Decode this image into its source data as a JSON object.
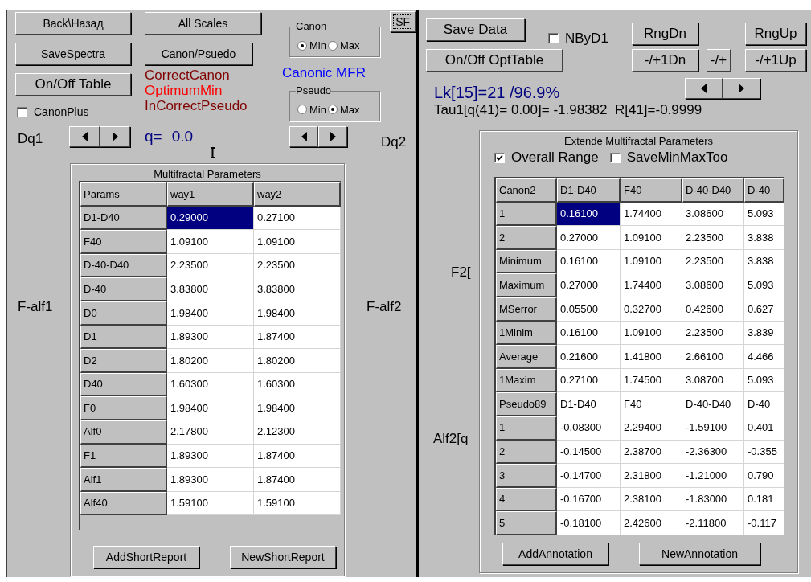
{
  "left": {
    "back_button": "Back\\Назад",
    "all_scales_button": "All Scales",
    "save_spectra_button": "SaveSpectra",
    "canon_pseudo_button": "Canon/Psuedo",
    "table_toggle_button": "On/Off Table",
    "canon_plus": {
      "label": "CanonPlus",
      "checked": false
    },
    "status_labels": [
      {
        "text": "CorrectCanon",
        "color": "#800000"
      },
      {
        "text": "OptimumMin",
        "color": "#ff0000"
      },
      {
        "text": "InCorrectPseudo",
        "color": "#800000"
      }
    ],
    "canon_group": {
      "title": "Canon",
      "options": [
        {
          "label": "Min",
          "selected": true
        },
        {
          "label": "Max",
          "selected": false
        }
      ]
    },
    "mode_label": "Canonic MFR",
    "pseudo_group": {
      "title": "Pseudo",
      "options": [
        {
          "label": "Min",
          "selected": false
        },
        {
          "label": "Max",
          "selected": true
        }
      ]
    },
    "sf_button": "SF",
    "dq1_label": "Dq1",
    "q_label": "q=",
    "q_value": "0.0",
    "dq2_label": "Dq2",
    "f_alf1_label": "F-alf1",
    "f_alf2_label": "F-alf2",
    "table": {
      "title": "Multifractal Parameters",
      "columns": [
        "Params",
        "way1",
        "way2"
      ],
      "rows": [
        {
          "cells": [
            {
              "kind": "header",
              "text": "D1-D40"
            },
            {
              "kind": "value",
              "text": "0.29000",
              "selected": true
            },
            {
              "kind": "value",
              "text": "0.27100",
              "selected": false
            }
          ]
        },
        {
          "cells": [
            {
              "kind": "header",
              "text": "F40"
            },
            {
              "kind": "value",
              "text": "1.09100",
              "selected": false
            },
            {
              "kind": "value",
              "text": "1.09100",
              "selected": false
            }
          ]
        },
        {
          "cells": [
            {
              "kind": "header",
              "text": "D-40-D40"
            },
            {
              "kind": "value",
              "text": "2.23500",
              "selected": false
            },
            {
              "kind": "value",
              "text": "2.23500",
              "selected": false
            }
          ]
        },
        {
          "cells": [
            {
              "kind": "header",
              "text": "D-40"
            },
            {
              "kind": "value",
              "text": "3.83800",
              "selected": false
            },
            {
              "kind": "value",
              "text": "3.83800",
              "selected": false
            }
          ]
        },
        {
          "cells": [
            {
              "kind": "header",
              "text": "D0"
            },
            {
              "kind": "value",
              "text": "1.98400",
              "selected": false
            },
            {
              "kind": "value",
              "text": "1.98400",
              "selected": false
            }
          ]
        },
        {
          "cells": [
            {
              "kind": "header",
              "text": "D1"
            },
            {
              "kind": "value",
              "text": "1.89300",
              "selected": false
            },
            {
              "kind": "value",
              "text": "1.87400",
              "selected": false
            }
          ]
        },
        {
          "cells": [
            {
              "kind": "header",
              "text": "D2"
            },
            {
              "kind": "value",
              "text": "1.80200",
              "selected": false
            },
            {
              "kind": "value",
              "text": "1.80200",
              "selected": false
            }
          ]
        },
        {
          "cells": [
            {
              "kind": "header",
              "text": "D40"
            },
            {
              "kind": "value",
              "text": "1.60300",
              "selected": false
            },
            {
              "kind": "value",
              "text": "1.60300",
              "selected": false
            }
          ]
        },
        {
          "cells": [
            {
              "kind": "header",
              "text": "F0"
            },
            {
              "kind": "value",
              "text": "1.98400",
              "selected": false
            },
            {
              "kind": "value",
              "text": "1.98400",
              "selected": false
            }
          ]
        },
        {
          "cells": [
            {
              "kind": "header",
              "text": "Alf0"
            },
            {
              "kind": "value",
              "text": "2.17800",
              "selected": false
            },
            {
              "kind": "value",
              "text": "2.12300",
              "selected": false
            }
          ]
        },
        {
          "cells": [
            {
              "kind": "header",
              "text": "F1"
            },
            {
              "kind": "value",
              "text": "1.89300",
              "selected": false
            },
            {
              "kind": "value",
              "text": "1.87400",
              "selected": false
            }
          ]
        },
        {
          "cells": [
            {
              "kind": "header",
              "text": "Alf1"
            },
            {
              "kind": "value",
              "text": "1.89300",
              "selected": false
            },
            {
              "kind": "value",
              "text": "1.87400",
              "selected": false
            }
          ]
        },
        {
          "cells": [
            {
              "kind": "header",
              "text": "Alf40"
            },
            {
              "kind": "value",
              "text": "1.59100",
              "selected": false
            },
            {
              "kind": "value",
              "text": "1.59100",
              "selected": false
            }
          ]
        }
      ]
    },
    "add_report_button": "AddShortReport",
    "new_report_button": "NewShortReport"
  },
  "right": {
    "save_button": "Save Data",
    "nbyd1": {
      "label": "NByD1",
      "checked": false
    },
    "range_down_button": "RngDn",
    "range_up_button": "RngUp",
    "opt_table_button": "On/Off OptTable",
    "step_down_button": "-/+1Dn",
    "step_button": "-/+",
    "step_up_button": "-/+1Up",
    "lk_label": "Lk[15]=21 /96.9%",
    "tau_label": "Tau1[q(41)= 0.00]= -1.98382  R[41]=-0.9999",
    "f2_label": "F2[",
    "alf2_label": "Alf2[q",
    "table": {
      "title": "Extende Multifractal Parameters",
      "overall_range": {
        "label": "Overall Range",
        "checked": true
      },
      "save_min_max": {
        "label": "SaveMinMaxToo",
        "checked": false
      },
      "columns": [
        "Canon2",
        "D1-D40",
        "F40",
        "D-40-D40",
        "D-40"
      ],
      "rows": [
        {
          "cells": [
            {
              "kind": "header",
              "text": "1"
            },
            {
              "kind": "value",
              "text": "0.16100",
              "selected": true
            },
            {
              "kind": "value",
              "text": "1.74400",
              "selected": false
            },
            {
              "kind": "value",
              "text": "3.08600",
              "selected": false
            },
            {
              "kind": "value",
              "text": "5.093",
              "selected": false
            }
          ]
        },
        {
          "cells": [
            {
              "kind": "header",
              "text": "2"
            },
            {
              "kind": "value",
              "text": "0.27000",
              "selected": false
            },
            {
              "kind": "value",
              "text": "1.09100",
              "selected": false
            },
            {
              "kind": "value",
              "text": "2.23500",
              "selected": false
            },
            {
              "kind": "value",
              "text": "3.838",
              "selected": false
            }
          ]
        },
        {
          "cells": [
            {
              "kind": "header",
              "text": "Minimum"
            },
            {
              "kind": "value",
              "text": "0.16100",
              "selected": false
            },
            {
              "kind": "value",
              "text": "1.09100",
              "selected": false
            },
            {
              "kind": "value",
              "text": "2.23500",
              "selected": false
            },
            {
              "kind": "value",
              "text": "3.838",
              "selected": false
            }
          ]
        },
        {
          "cells": [
            {
              "kind": "header",
              "text": "Maximum"
            },
            {
              "kind": "value",
              "text": "0.27000",
              "selected": false
            },
            {
              "kind": "value",
              "text": "1.74400",
              "selected": false
            },
            {
              "kind": "value",
              "text": "3.08600",
              "selected": false
            },
            {
              "kind": "value",
              "text": "5.093",
              "selected": false
            }
          ]
        },
        {
          "cells": [
            {
              "kind": "header",
              "text": "MSerror"
            },
            {
              "kind": "value",
              "text": "0.05500",
              "selected": false
            },
            {
              "kind": "value",
              "text": "0.32700",
              "selected": false
            },
            {
              "kind": "value",
              "text": "0.42600",
              "selected": false
            },
            {
              "kind": "value",
              "text": "0.627",
              "selected": false
            }
          ]
        },
        {
          "cells": [
            {
              "kind": "header",
              "text": "1Minim"
            },
            {
              "kind": "value",
              "text": "0.16100",
              "selected": false
            },
            {
              "kind": "value",
              "text": "1.09100",
              "selected": false
            },
            {
              "kind": "value",
              "text": "2.23500",
              "selected": false
            },
            {
              "kind": "value",
              "text": "3.839",
              "selected": false
            }
          ]
        },
        {
          "cells": [
            {
              "kind": "header",
              "text": "Average"
            },
            {
              "kind": "value",
              "text": "0.21600",
              "selected": false
            },
            {
              "kind": "value",
              "text": "1.41800",
              "selected": false
            },
            {
              "kind": "value",
              "text": "2.66100",
              "selected": false
            },
            {
              "kind": "value",
              "text": "4.466",
              "selected": false
            }
          ]
        },
        {
          "cells": [
            {
              "kind": "header",
              "text": "1Maxim"
            },
            {
              "kind": "value",
              "text": "0.27100",
              "selected": false
            },
            {
              "kind": "value",
              "text": "1.74500",
              "selected": false
            },
            {
              "kind": "value",
              "text": "3.08700",
              "selected": false
            },
            {
              "kind": "value",
              "text": "5.093",
              "selected": false
            }
          ]
        },
        {
          "cells": [
            {
              "kind": "header",
              "text": "Pseudo89"
            },
            {
              "kind": "value",
              "text": "D1-D40",
              "selected": false
            },
            {
              "kind": "value",
              "text": "F40",
              "selected": false
            },
            {
              "kind": "value",
              "text": "D-40-D40",
              "selected": false
            },
            {
              "kind": "value",
              "text": "D-40",
              "selected": false
            }
          ]
        },
        {
          "cells": [
            {
              "kind": "header",
              "text": "1"
            },
            {
              "kind": "value",
              "text": "-0.08300",
              "selected": false
            },
            {
              "kind": "value",
              "text": "2.29400",
              "selected": false
            },
            {
              "kind": "value",
              "text": "-1.59100",
              "selected": false
            },
            {
              "kind": "value",
              "text": "0.401",
              "selected": false
            }
          ]
        },
        {
          "cells": [
            {
              "kind": "header",
              "text": "2"
            },
            {
              "kind": "value",
              "text": "-0.14500",
              "selected": false
            },
            {
              "kind": "value",
              "text": "2.38700",
              "selected": false
            },
            {
              "kind": "value",
              "text": "-2.36300",
              "selected": false
            },
            {
              "kind": "value",
              "text": "-0.355",
              "selected": false
            }
          ]
        },
        {
          "cells": [
            {
              "kind": "header",
              "text": "3"
            },
            {
              "kind": "value",
              "text": "-0.14700",
              "selected": false
            },
            {
              "kind": "value",
              "text": "2.31800",
              "selected": false
            },
            {
              "kind": "value",
              "text": "-1.21000",
              "selected": false
            },
            {
              "kind": "value",
              "text": "0.790",
              "selected": false
            }
          ]
        },
        {
          "cells": [
            {
              "kind": "header",
              "text": "4"
            },
            {
              "kind": "value",
              "text": "-0.16700",
              "selected": false
            },
            {
              "kind": "value",
              "text": "2.38100",
              "selected": false
            },
            {
              "kind": "value",
              "text": "-1.83000",
              "selected": false
            },
            {
              "kind": "value",
              "text": "0.181",
              "selected": false
            }
          ]
        },
        {
          "cells": [
            {
              "kind": "header",
              "text": "5"
            },
            {
              "kind": "value",
              "text": "-0.18100",
              "selected": false
            },
            {
              "kind": "value",
              "text": "2.42600",
              "selected": false
            },
            {
              "kind": "value",
              "text": "-2.11800",
              "selected": false
            },
            {
              "kind": "value",
              "text": "-0.117",
              "selected": false
            }
          ]
        }
      ]
    },
    "add_annotation_button": "AddAnnotation",
    "new_annotation_button": "NewAnnotation"
  }
}
